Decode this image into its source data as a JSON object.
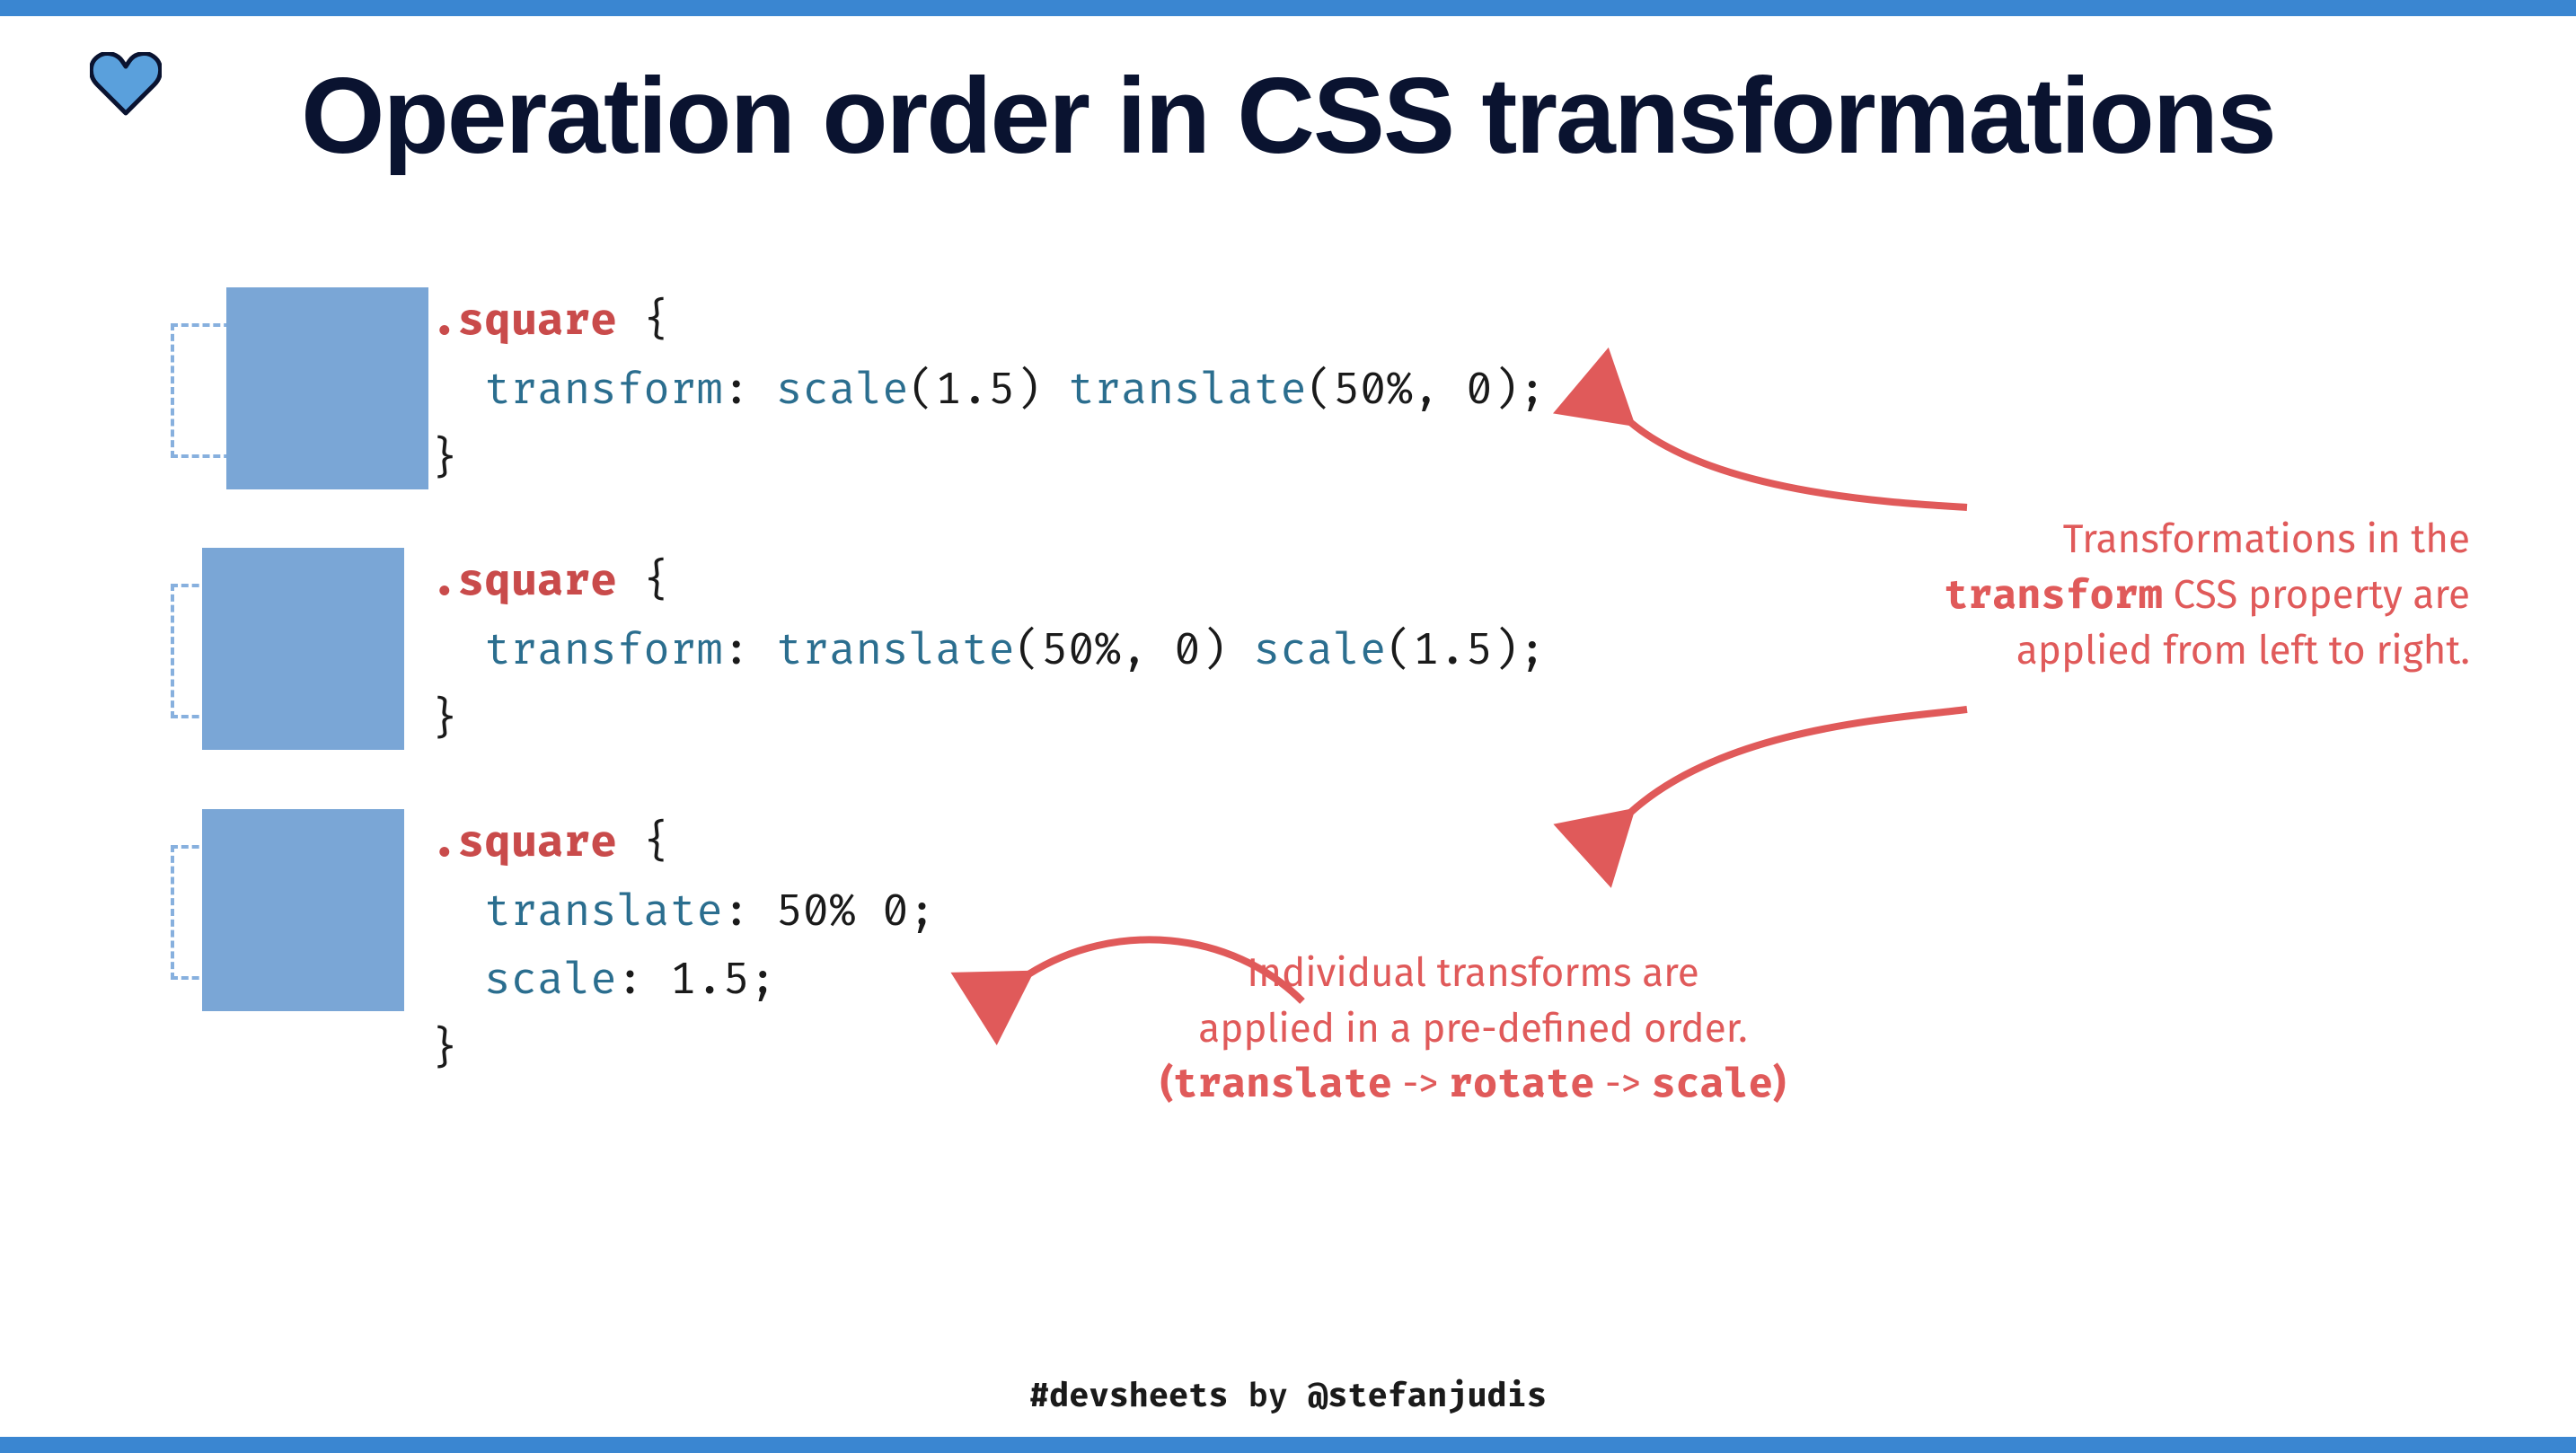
{
  "title": "Operation order in CSS transformations",
  "examples": [
    {
      "selector": ".square",
      "props": [
        {
          "name": "transform",
          "value_display": "scale(1.5) translate(50%, 0)"
        }
      ]
    },
    {
      "selector": ".square",
      "props": [
        {
          "name": "transform",
          "value_display": "translate(50%, 0) scale(1.5)"
        }
      ]
    },
    {
      "selector": ".square",
      "props": [
        {
          "name": "translate",
          "value_display": "50% 0"
        },
        {
          "name": "scale",
          "value_display": "1.5"
        }
      ]
    }
  ],
  "notes": {
    "right": {
      "line1": "Transformations in the",
      "code_word": "transform",
      "line2_rest": " CSS property are",
      "line3": "applied from left to right."
    },
    "bottom": {
      "line1": "Individual transforms are",
      "line2": "applied in a pre-defined order.",
      "order_open": "(",
      "order_t": "translate",
      "order_sep1": " -> ",
      "order_r": "rotate",
      "order_sep2": " -> ",
      "order_s": "scale",
      "order_close": ")"
    }
  },
  "footer": {
    "hashtag": "#devsheets",
    "by": " by ",
    "handle": "@stefanjudis"
  },
  "colors": {
    "accent_blue": "#3a86d1",
    "box_fill": "#7aa6d6",
    "dashed": "#87b0de",
    "red": "#e05a5a",
    "dark": "#0a1330"
  }
}
